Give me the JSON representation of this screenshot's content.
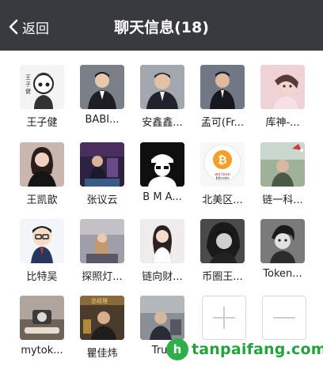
{
  "header": {
    "back_label": "返回",
    "title": "聊天信息(18)"
  },
  "members": [
    {
      "name": "王子健",
      "avatar_bg": "#f4f4f4"
    },
    {
      "name": "BABI...",
      "avatar_bg": "#6b6f78"
    },
    {
      "name": "安鑫鑫...",
      "avatar_bg": "#8c9099"
    },
    {
      "name": "孟可(Fr...",
      "avatar_bg": "#5c6470"
    },
    {
      "name": "库神-...",
      "avatar_bg": "#e7c3c9"
    },
    {
      "name": "王凯歆",
      "avatar_bg": "#bfa7a0"
    },
    {
      "name": "张议云",
      "avatar_bg": "#3b2a4a"
    },
    {
      "name": "B M A...",
      "avatar_bg": "#111111"
    },
    {
      "name": "北美区...",
      "avatar_bg": "#f5f5f5"
    },
    {
      "name": "链一科...",
      "avatar_bg": "#8ea087"
    },
    {
      "name": "比特吴",
      "avatar_bg": "#eef2f7"
    },
    {
      "name": "探照灯...",
      "avatar_bg": "#8f8d96"
    },
    {
      "name": "链向财...",
      "avatar_bg": "#e9e6e4"
    },
    {
      "name": "币圈王...",
      "avatar_bg": "#3a3a3a"
    },
    {
      "name": "Token...",
      "avatar_bg": "#6a6a6a"
    },
    {
      "name": "mytok...",
      "avatar_bg": "#9a8f86"
    },
    {
      "name": "瞿佳炜",
      "avatar_bg": "#5a4b38"
    },
    {
      "name": "Trus",
      "avatar_bg": "#7b7f86"
    }
  ],
  "actions": {
    "add_icon": "plus-icon",
    "remove_icon": "minus-icon"
  },
  "watermark": {
    "logo_letter": "h",
    "text": "tanpaifang.com"
  },
  "colors": {
    "nav_bg": "#393a3f",
    "watermark_green": "#22a33c",
    "action_border": "#d8d8d8"
  }
}
